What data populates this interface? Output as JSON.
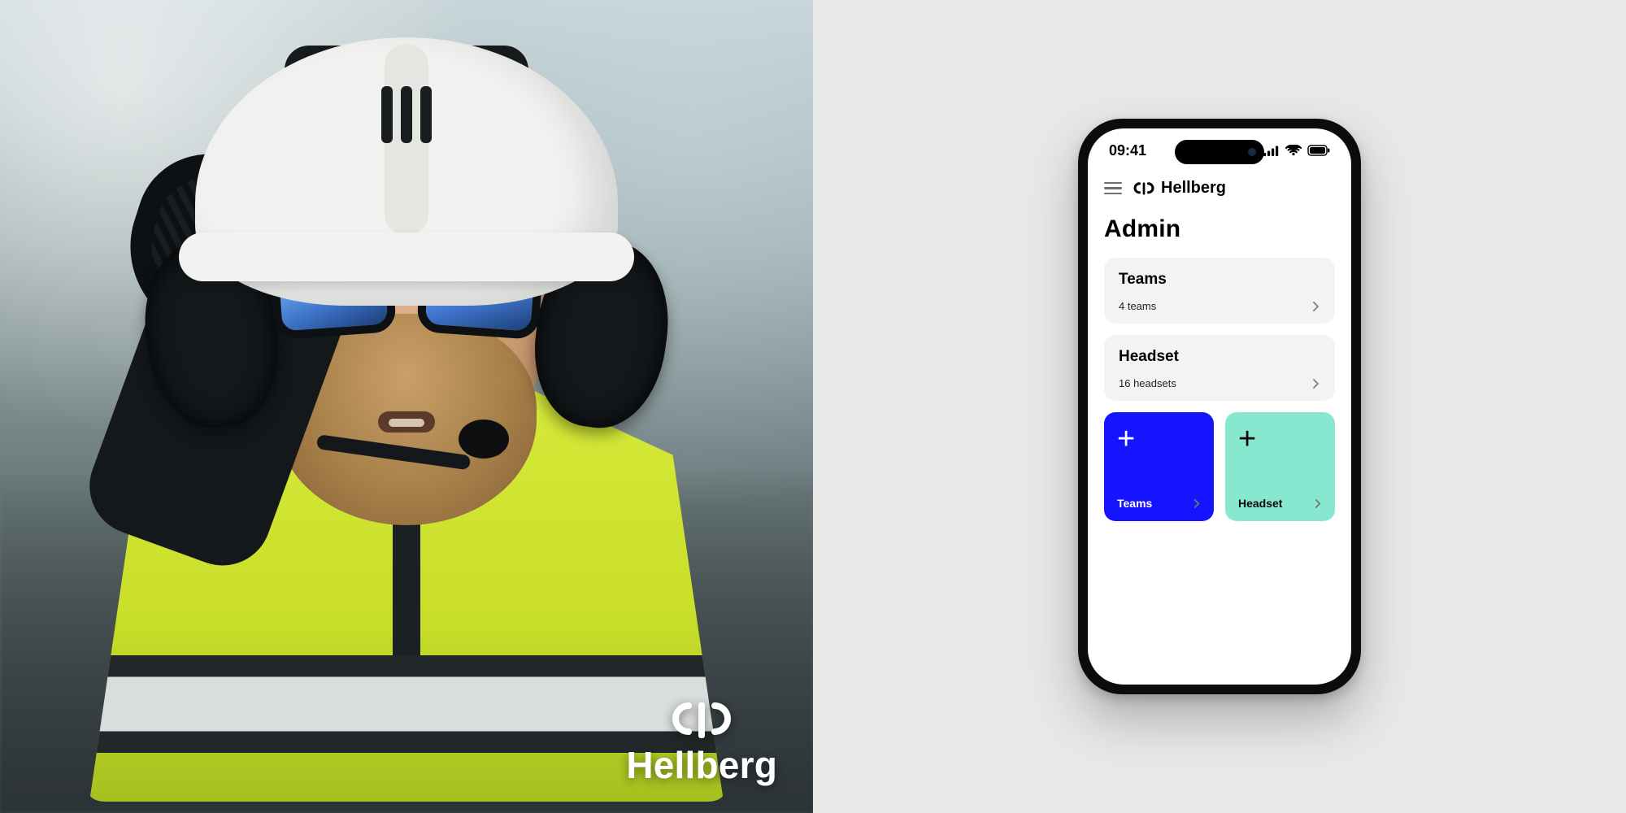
{
  "brand": {
    "name": "Hellberg"
  },
  "status": {
    "time": "09:41"
  },
  "app": {
    "header_brand": "Hellberg",
    "page_title": "Admin",
    "cards": [
      {
        "title": "Teams",
        "subtitle": "4 teams"
      },
      {
        "title": "Headset",
        "subtitle": "16 headsets"
      }
    ],
    "tiles": [
      {
        "label": "Teams",
        "style": "blue"
      },
      {
        "label": "Headset",
        "style": "mint"
      }
    ]
  },
  "colors": {
    "blue": "#1414ff",
    "mint": "#87e8cf",
    "card": "#f3f3f3",
    "bg_right": "#e8e9e6"
  }
}
